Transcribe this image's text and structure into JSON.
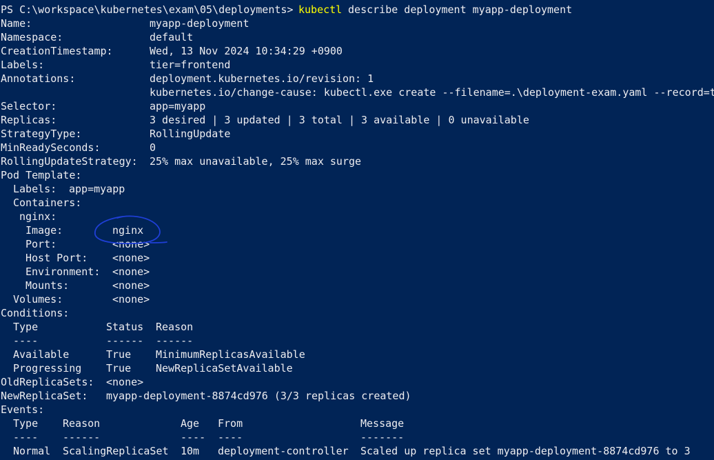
{
  "colors": {
    "background": "#012456",
    "text": "#eeedf0",
    "command": "#ffff00",
    "annotation": "#1f3fd6"
  },
  "prompt": {
    "path": "PS C:\\workspace\\kubernetes\\exam\\05\\deployments> ",
    "command": "kubectl",
    "args": " describe deployment myapp-deployment"
  },
  "fields": {
    "name": {
      "label": "Name:",
      "value": "myapp-deployment"
    },
    "namespace": {
      "label": "Namespace:",
      "value": "default"
    },
    "creation": {
      "label": "CreationTimestamp:",
      "value": "Wed, 13 Nov 2024 10:34:29 +0900"
    },
    "labels": {
      "label": "Labels:",
      "value": "tier=frontend"
    },
    "annotations": {
      "label": "Annotations:",
      "value": "deployment.kubernetes.io/revision: 1",
      "value2": "kubernetes.io/change-cause: kubectl.exe create --filename=.\\deployment-exam.yaml --record=t"
    },
    "selector": {
      "label": "Selector:",
      "value": "app=myapp"
    },
    "replicas": {
      "label": "Replicas:",
      "value": "3 desired | 3 updated | 3 total | 3 available | 0 unavailable"
    },
    "strategy": {
      "label": "StrategyType:",
      "value": "RollingUpdate"
    },
    "minready": {
      "label": "MinReadySeconds:",
      "value": "0"
    },
    "rolling": {
      "label": "RollingUpdateStrategy:",
      "value": "25% max unavailable, 25% max surge"
    }
  },
  "pod_template": {
    "heading": "Pod Template:",
    "labels": {
      "label": "Labels:",
      "value": "app=myapp"
    },
    "containers_label": "Containers:",
    "container_name": "nginx:",
    "image": {
      "label": "Image:",
      "value": "nginx"
    },
    "port": {
      "label": "Port:",
      "value": "<none>"
    },
    "host_port": {
      "label": "Host Port:",
      "value": "<none>"
    },
    "environment": {
      "label": "Environment:",
      "value": "<none>"
    },
    "mounts": {
      "label": "Mounts:",
      "value": "<none>"
    },
    "volumes": {
      "label": "Volumes:",
      "value": "<none>"
    }
  },
  "conditions": {
    "heading": "Conditions:",
    "headers": {
      "type": "Type",
      "status": "Status",
      "reason": "Reason"
    },
    "dashes": {
      "type": "----",
      "status": "------",
      "reason": "------"
    },
    "rows": [
      {
        "type": "Available",
        "status": "True",
        "reason": "MinimumReplicasAvailable"
      },
      {
        "type": "Progressing",
        "status": "True",
        "reason": "NewReplicaSetAvailable"
      }
    ]
  },
  "replica_sets": {
    "old": {
      "label": "OldReplicaSets:",
      "value": "<none>"
    },
    "new": {
      "label": "NewReplicaSet:",
      "value": "myapp-deployment-8874cd976 (3/3 replicas created)"
    }
  },
  "events": {
    "heading": "Events:",
    "headers": {
      "type": "Type",
      "reason": "Reason",
      "age": "Age",
      "from": "From",
      "message": "Message"
    },
    "dashes": {
      "type": "----",
      "reason": "------",
      "age": "----",
      "from": "----",
      "message": "-------"
    },
    "rows": [
      {
        "type": "Normal",
        "reason": "ScalingReplicaSet",
        "age": "10m",
        "from": "deployment-controller",
        "message": "Scaled up replica set myapp-deployment-8874cd976 to 3"
      }
    ]
  }
}
